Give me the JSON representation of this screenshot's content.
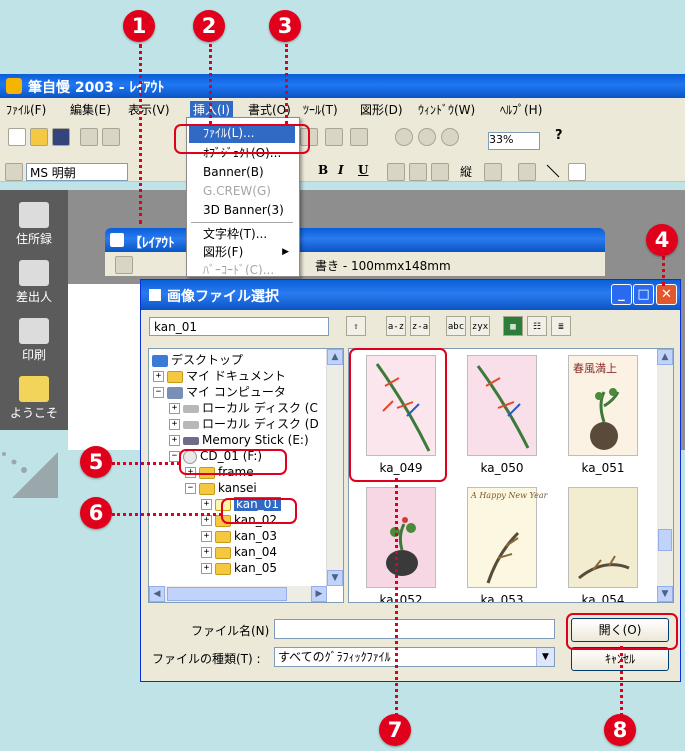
{
  "app": {
    "title": "筆自慢 2003 - ﾚｲｱｳﾄ",
    "menus": [
      "ﾌｧｲﾙ(F)",
      "編集(E)",
      "表示(V)",
      "挿入(I)",
      "書式(O)",
      "ﾂｰﾙ(T)",
      "図形(D)",
      "ｳｨﾝﾄﾞｳ(W)",
      "ﾍﾙﾌﾟ(H)"
    ],
    "font_name": "MS 明朝",
    "zoom": "33%",
    "sidebar": [
      "住所録",
      "差出人",
      "印刷",
      "ようこそ"
    ]
  },
  "layout_window": {
    "title": "【ﾚｲｱｳﾄ",
    "size_text": "書き - 100mmx148mm"
  },
  "insert_menu": {
    "items": [
      {
        "label": "ﾌｧｲﾙ(L)...",
        "state": "highlighted"
      },
      {
        "label": "ｵﾌﾞｼﾞｪｸﾄ(O)...",
        "state": "normal"
      },
      {
        "label": "Banner(B)",
        "state": "normal"
      },
      {
        "label": "G.CREW(G)",
        "state": "disabled"
      },
      {
        "label": "3D Banner(3)",
        "state": "normal"
      },
      {
        "label": "文字枠(T)...",
        "state": "normal"
      },
      {
        "label": "図形(F)",
        "state": "normal",
        "submenu": true
      },
      {
        "label": "ﾊﾞｰｺｰﾄﾞ(C)...",
        "state": "disabled"
      }
    ]
  },
  "dialog": {
    "title": "画像ファイル選択",
    "path": "kan_01",
    "tree": [
      {
        "label": "デスクトップ",
        "icon": "desktop-icon"
      },
      {
        "label": "マイ ドキュメント",
        "icon": "documents-icon"
      },
      {
        "label": "マイ コンピュータ",
        "icon": "computer-icon"
      },
      {
        "label": "ローカル ディスク (C",
        "icon": "drive-icon"
      },
      {
        "label": "ローカル ディスク (D",
        "icon": "drive-icon"
      },
      {
        "label": "Memory Stick (E:)",
        "icon": "drive-icon"
      },
      {
        "label": "CD_01 (F:)",
        "icon": "cd-icon"
      },
      {
        "label": "frame",
        "icon": "folder-icon"
      },
      {
        "label": "kansei",
        "icon": "folder-icon"
      },
      {
        "label": "kan_01",
        "icon": "folder-icon",
        "selected": true
      },
      {
        "label": "kan_02",
        "icon": "folder-icon"
      },
      {
        "label": "kan_03",
        "icon": "folder-icon"
      },
      {
        "label": "kan_04",
        "icon": "folder-icon"
      },
      {
        "label": "kan_05",
        "icon": "folder-icon"
      }
    ],
    "thumbnails": [
      {
        "name": "ka_049",
        "bg": "#fbe6ee",
        "card_text": ""
      },
      {
        "name": "ka_050",
        "bg": "#f8dfe9",
        "card_text": ""
      },
      {
        "name": "ka_051",
        "bg": "#fbf2e4",
        "card_text": "春風満上"
      },
      {
        "name": "ka_052",
        "bg": "#f7d7e3",
        "card_text": ""
      },
      {
        "name": "ka_053",
        "bg": "#fbf7e0",
        "card_text": "A Happy New Year"
      },
      {
        "name": "ka_054",
        "bg": "#f2ecd0",
        "card_text": ""
      }
    ],
    "filename_label": "ファイル名(N) :",
    "filename_value": "",
    "filetype_label": "ファイルの種類(T) :",
    "filetype_value": "すべてのｸﾞﾗﾌｨｯｸﾌｧｲﾙ",
    "open_label": "開く(O)",
    "cancel_label": "ｷｬﾝｾﾙ"
  },
  "callouts": [
    "1",
    "2",
    "3",
    "4",
    "5",
    "6",
    "7",
    "8"
  ],
  "colors": {
    "callout": "#e0001b",
    "xp_blue": "#0a5fd7",
    "selection": "#316ac5",
    "backdrop": "#bfe3e6"
  }
}
